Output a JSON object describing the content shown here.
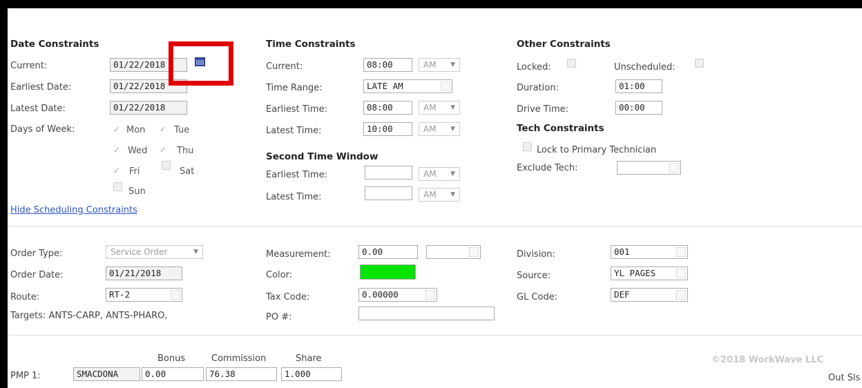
{
  "date_constraints": {
    "heading": "Date Constraints",
    "current_label": "Current:",
    "current_value": "01/22/2018",
    "earliest_label": "Earliest Date:",
    "earliest_value": "01/22/2018",
    "latest_label": "Latest Date:",
    "latest_value": "01/22/2018",
    "days_label": "Days of Week:",
    "days": {
      "mon": "Mon",
      "tue": "Tue",
      "wed": "Wed",
      "thu": "Thu",
      "fri": "Fri",
      "sat": "Sat",
      "sun": "Sun"
    },
    "days_checked": {
      "mon": true,
      "tue": true,
      "wed": true,
      "thu": true,
      "fri": true,
      "sat": false,
      "sun": false
    },
    "hide_link": "Hide Scheduling Constraints"
  },
  "time_constraints": {
    "heading": "Time Constraints",
    "current_label": "Current:",
    "current_value": "08:00",
    "current_ampm": "AM",
    "range_label": "Time Range:",
    "range_value": "LATE AM",
    "earliest_label": "Earliest Time:",
    "earliest_value": "08:00",
    "earliest_ampm": "AM",
    "latest_label": "Latest Time:",
    "latest_value": "10:00",
    "latest_ampm": "AM"
  },
  "second_window": {
    "heading": "Second Time Window",
    "earliest_label": "Earliest Time:",
    "earliest_value": "",
    "earliest_ampm": "AM",
    "latest_label": "Latest Time:",
    "latest_value": "",
    "latest_ampm": "AM"
  },
  "other_constraints": {
    "heading": "Other Constraints",
    "locked_label": "Locked:",
    "unscheduled_label": "Unscheduled:",
    "duration_label": "Duration:",
    "duration_value": "01:00",
    "drive_label": "Drive Time:",
    "drive_value": "00:00"
  },
  "tech_constraints": {
    "heading": "Tech Constraints",
    "lock_primary_label": "Lock to Primary Technician",
    "exclude_label": "Exclude Tech:",
    "exclude_value": ""
  },
  "order": {
    "type_label": "Order Type:",
    "type_value": "Service Order",
    "date_label": "Order Date:",
    "date_value": "01/21/2018",
    "route_label": "Route:",
    "route_value": "RT-2",
    "targets_text": "Targets: ANTS-CARP, ANTS-PHARO,",
    "measurement_label": "Measurement:",
    "measurement_value": "0.00",
    "measurement_unit": "",
    "color_label": "Color:",
    "color_value": "#00e400",
    "tax_label": "Tax Code:",
    "tax_value": "0.00000",
    "po_label": "PO #:",
    "po_value": "",
    "division_label": "Division:",
    "division_value": "001",
    "source_label": "Source:",
    "source_value": "YL PAGES",
    "gl_label": "GL Code:",
    "gl_value": "DEF"
  },
  "commission": {
    "bonus_header": "Bonus",
    "commission_header": "Commission",
    "share_header": "Share",
    "pmp1_label": "PMP 1:",
    "pmp1_code": "SMACDONA",
    "pmp1_bonus": "0.00",
    "pmp1_commission": "76.38",
    "pmp1_share": "1.000",
    "out_sls_label": "Out Sls"
  },
  "footer": {
    "copyright": "©2018 WorkWave LLC"
  },
  "highlight": {
    "color": "#e00000",
    "target": "calendar-icon"
  }
}
